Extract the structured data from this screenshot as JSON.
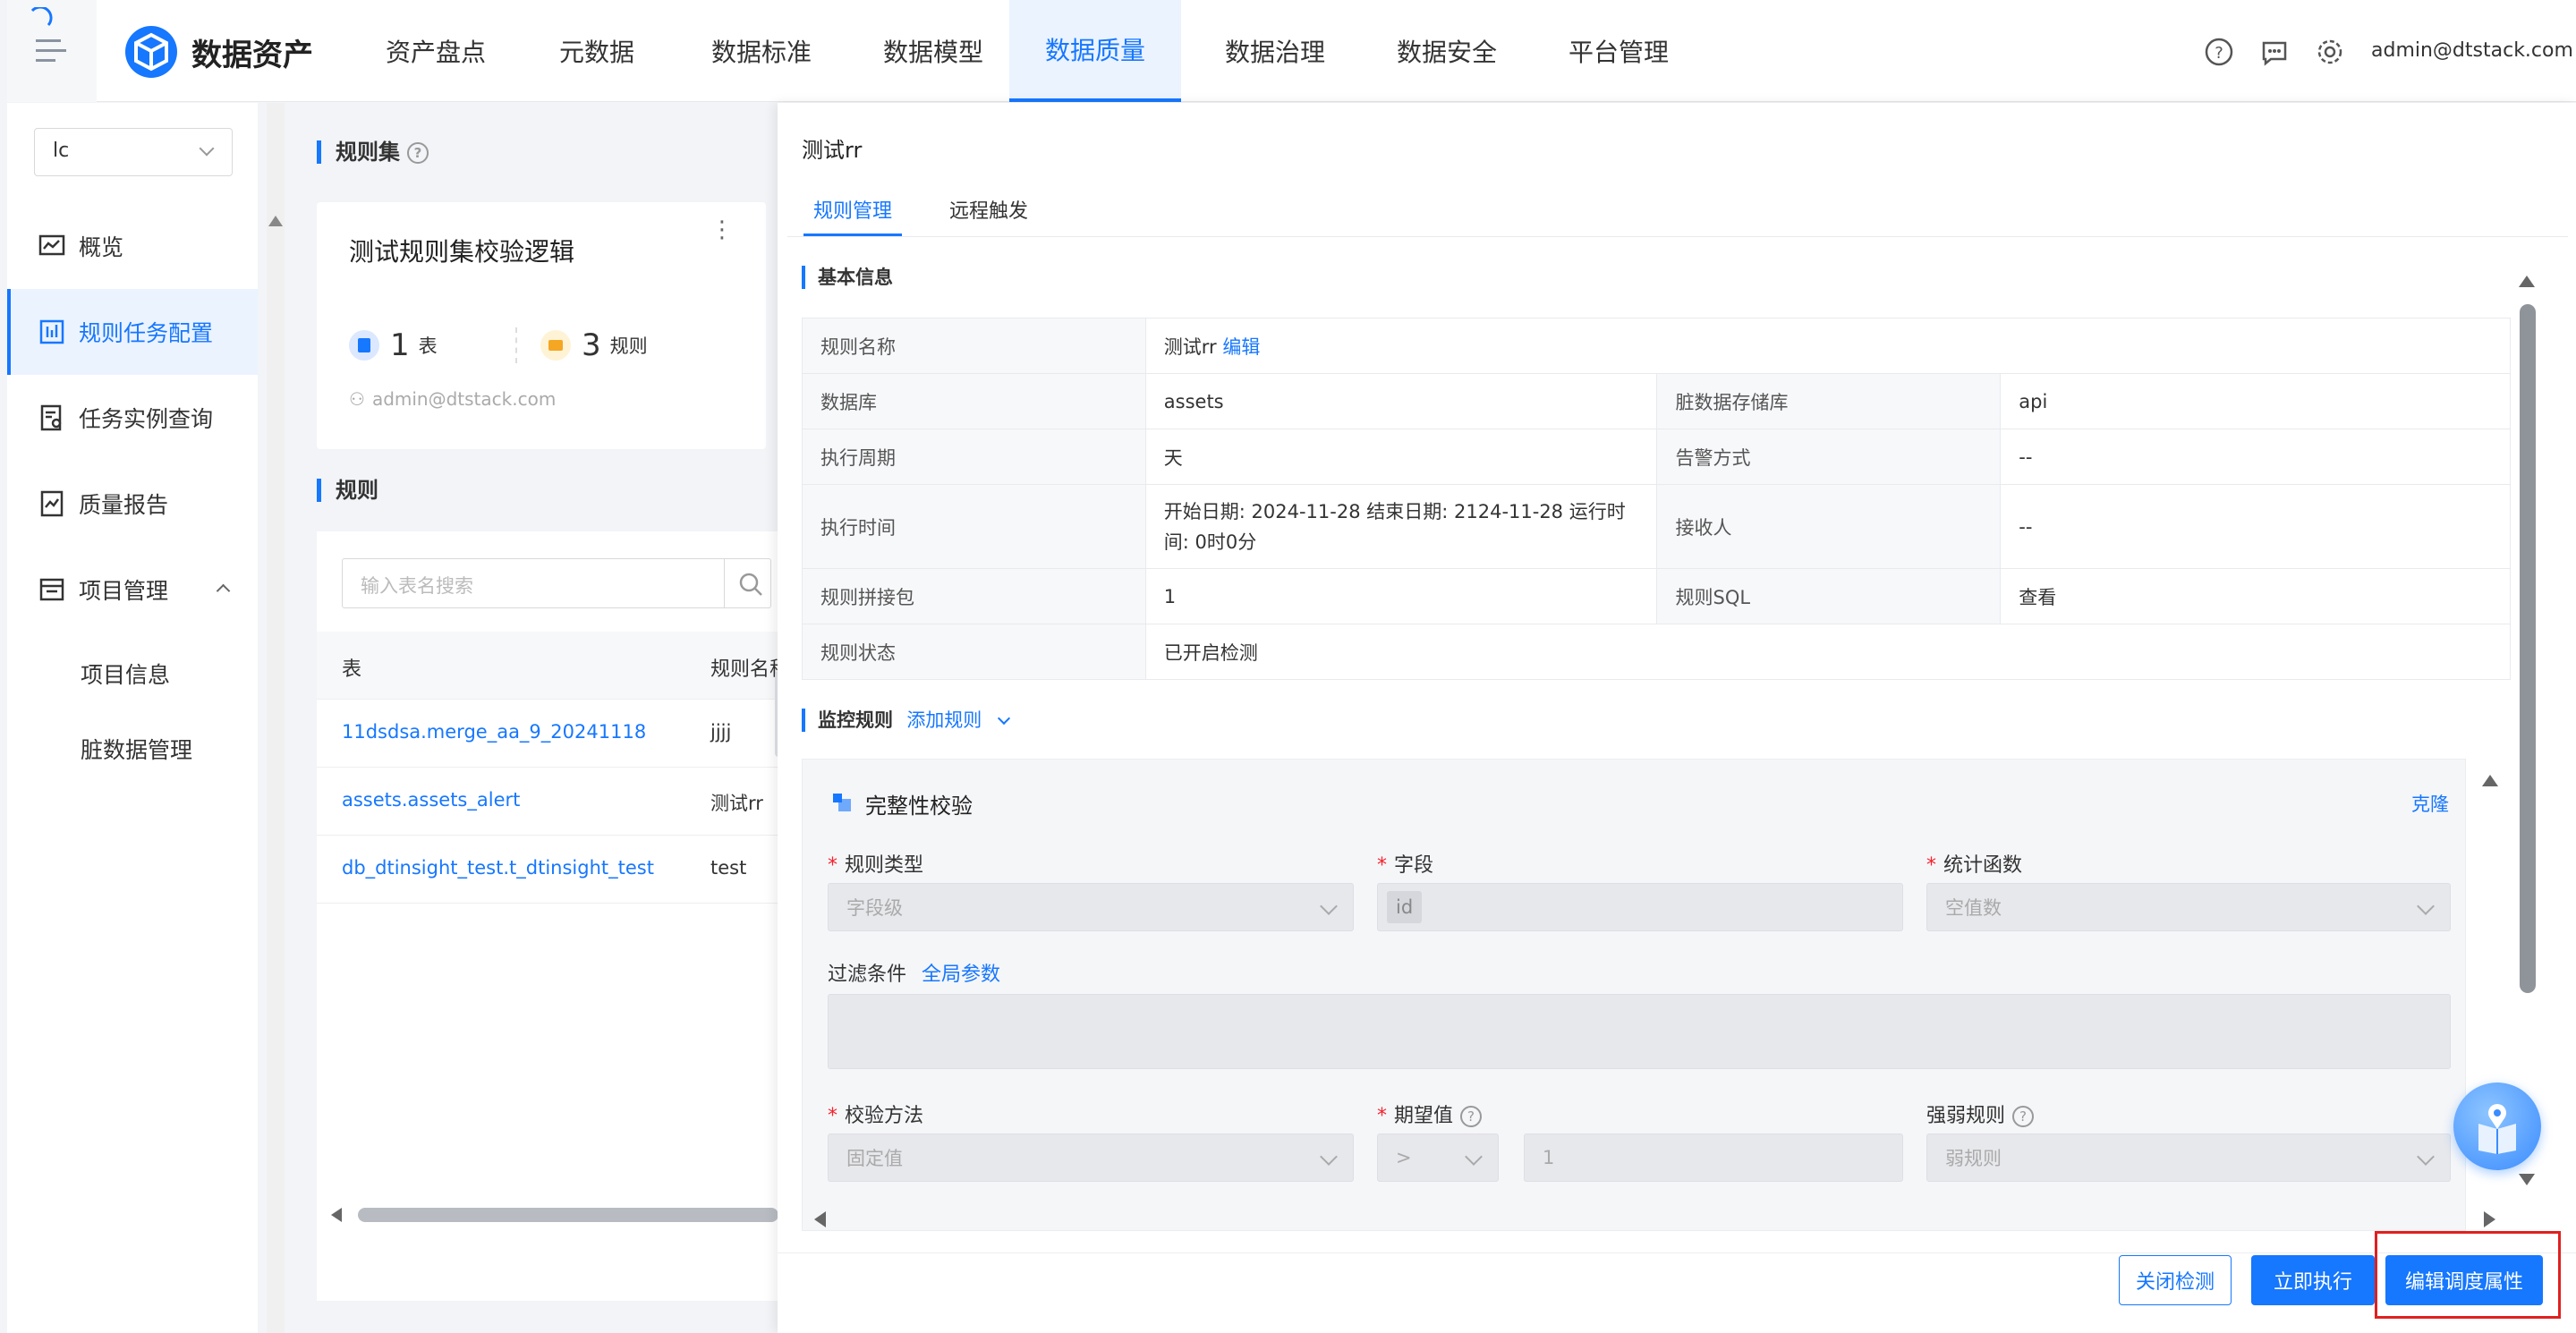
{
  "header": {
    "logo_text": "数据资产",
    "nav": [
      "资产盘点",
      "元数据",
      "数据标准",
      "数据模型",
      "数据质量",
      "数据治理",
      "数据安全",
      "平台管理"
    ],
    "active_nav": "数据质量",
    "user": "admin@dtstack.com",
    "icons": [
      "help-icon",
      "message-icon",
      "settings-icon"
    ]
  },
  "sidebar": {
    "project_select": "lc",
    "items": [
      {
        "label": "概览",
        "icon": "overview-icon"
      },
      {
        "label": "规则任务配置",
        "icon": "rule-task-icon"
      },
      {
        "label": "任务实例查询",
        "icon": "task-query-icon"
      },
      {
        "label": "质量报告",
        "icon": "report-icon"
      },
      {
        "label": "项目管理",
        "icon": "project-icon"
      }
    ],
    "sub_items": [
      "项目信息",
      "脏数据管理"
    ]
  },
  "middle": {
    "ruleset_title": "规则集",
    "card": {
      "name": "测试规则集校验逻辑",
      "tables_count": "1",
      "tables_unit": "表",
      "rules_count": "3",
      "rules_unit": "规则",
      "owner": "admin@dtstack.com"
    },
    "rules_title": "规则",
    "search_placeholder": "输入表名搜索",
    "columns": [
      "表",
      "规则名称"
    ],
    "rows": [
      {
        "table": "11dsdsa.merge_aa_9_20241118",
        "rule": "jjjj"
      },
      {
        "table": "assets.assets_alert",
        "rule": "测试rr"
      },
      {
        "table": "db_dtinsight_test.t_dtinsight_test",
        "rule": "test"
      }
    ]
  },
  "drawer": {
    "title": "测试rr",
    "tabs": [
      "规则管理",
      "远程触发"
    ],
    "basic_title": "基本信息",
    "info": {
      "rule_name_k": "规则名称",
      "rule_name_v": "测试rr",
      "edit": "编辑",
      "db_k": "数据库",
      "db_v": "assets",
      "dirty_k": "脏数据存储库",
      "dirty_v": "api",
      "cycle_k": "执行周期",
      "cycle_v": "天",
      "alarm_k": "告警方式",
      "alarm_v": "--",
      "time_k": "执行时间",
      "time_v": "开始日期: 2024-11-28 结束日期: 2124-11-28 运行时间: 0时0分",
      "receiver_k": "接收人",
      "receiver_v": "--",
      "pkg_k": "规则拼接包",
      "pkg_v": "1",
      "sql_k": "规则SQL",
      "sql_v": "查看",
      "status_k": "规则状态",
      "status_v": "已开启检测"
    },
    "monitor_title": "监控规则",
    "add_rule": "添加规则",
    "rule_card": {
      "name": "完整性校验",
      "clone": "克隆",
      "type_label": "规则类型",
      "type_value": "字段级",
      "field_label": "字段",
      "field_value": "id",
      "func_label": "统计函数",
      "func_value": "空值数",
      "filter_label": "过滤条件",
      "global_params": "全局参数",
      "method_label": "校验方法",
      "method_value": "固定值",
      "expect_label": "期望值",
      "expect_op": ">",
      "expect_value": "1",
      "strength_label": "强弱规则",
      "strength_value": "弱规则"
    },
    "buttons": {
      "close_check": "关闭检测",
      "run_now": "立即执行",
      "edit_schedule": "编辑调度属性"
    }
  },
  "colors": {
    "primary": "#1677ff",
    "highlight_box": "#e02020"
  }
}
